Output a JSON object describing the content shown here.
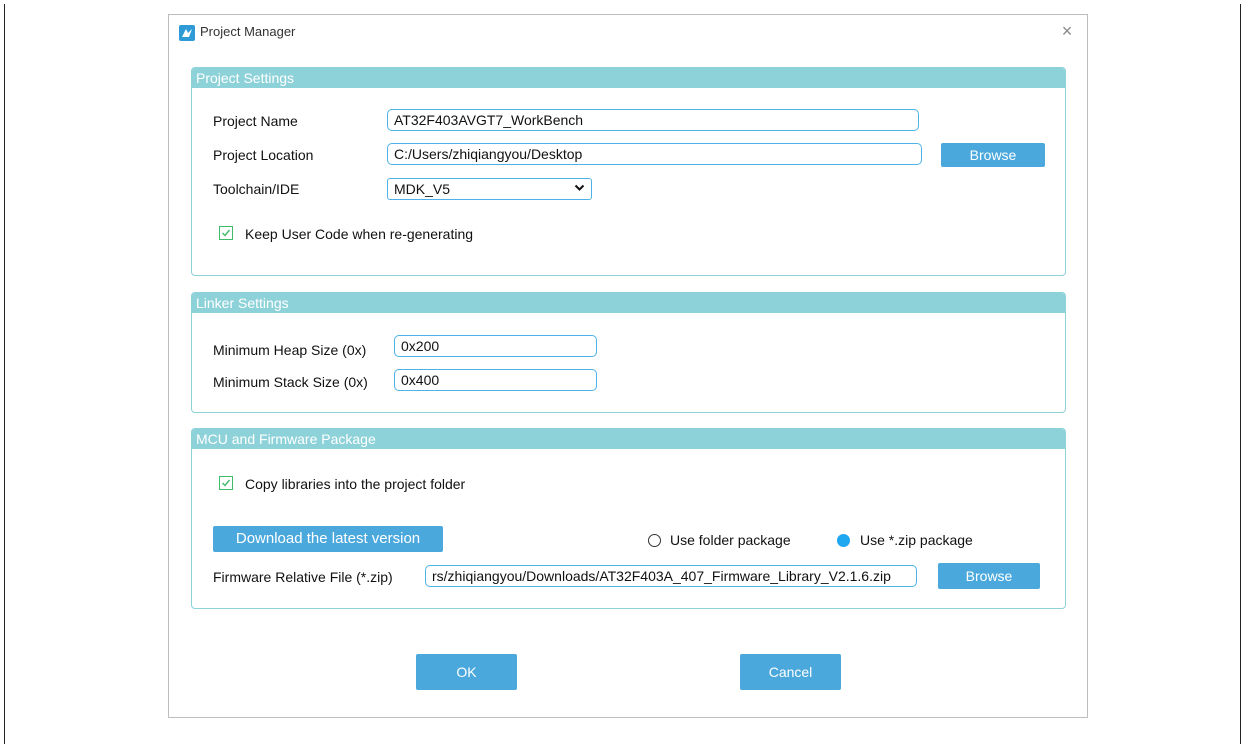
{
  "window": {
    "title": "Project Manager",
    "close_symbol": "×"
  },
  "project_settings": {
    "header": "Project Settings",
    "name_label": "Project Name",
    "name_value": "AT32F403AVGT7_WorkBench",
    "location_label": "Project Location",
    "location_value": "C:/Users/zhiqiangyou/Desktop",
    "browse_label": "Browse",
    "toolchain_label": "Toolchain/IDE",
    "toolchain_value": "MDK_V5",
    "keep_code_label": "Keep User Code when re-generating",
    "keep_code_checked": true
  },
  "linker_settings": {
    "header": "Linker Settings",
    "heap_label": "Minimum Heap Size (0x)",
    "heap_value": "0x200",
    "stack_label": "Minimum Stack Size (0x)",
    "stack_value": "0x400"
  },
  "mcu_firmware": {
    "header": "MCU and Firmware Package",
    "copy_libs_label": "Copy libraries into the project folder",
    "copy_libs_checked": true,
    "download_label": "Download the latest version",
    "folder_package_label": "Use folder package",
    "zip_package_label": "Use *.zip package",
    "selected_package": "zip",
    "firmware_label": "Firmware Relative File (*.zip)",
    "firmware_value": "rs/zhiqiangyou/Downloads/AT32F403A_407_Firmware_Library_V2.1.6.zip",
    "browse_label": "Browse"
  },
  "footer": {
    "ok_label": "OK",
    "cancel_label": "Cancel"
  },
  "colors": {
    "section_header": "#8ed2d9",
    "button": "#4aa8dd",
    "input_border": "#4db2e8",
    "checkbox": "#3ebc6a",
    "radio_selected": "#1fa7f0"
  }
}
